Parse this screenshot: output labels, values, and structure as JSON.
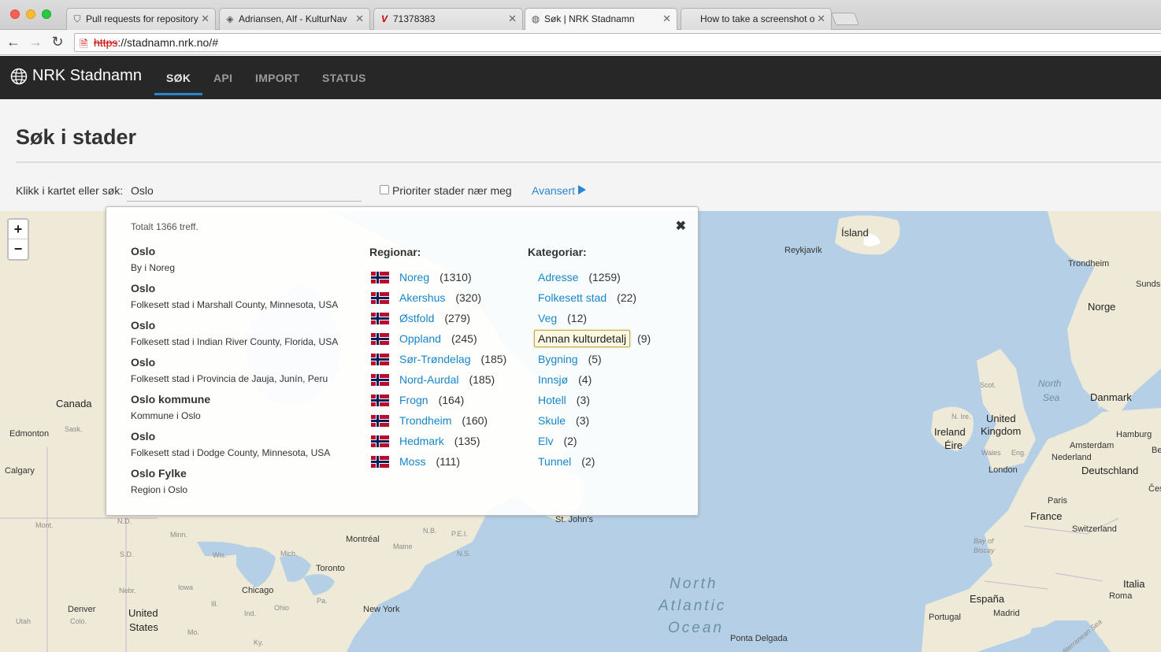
{
  "browser": {
    "tabs": [
      {
        "title": "Pull requests for repository",
        "icon": "shield-icon"
      },
      {
        "title": "Adriansen, Alf - KulturNav",
        "icon": "diamond-icon"
      },
      {
        "title": "71378383",
        "icon": "book-icon"
      },
      {
        "title": "Søk | NRK Stadnamn",
        "icon": "globe-icon",
        "active": true
      },
      {
        "title": "How to take a screenshot o",
        "icon": "apple-icon"
      }
    ],
    "url_scheme": "https",
    "url_rest": "://stadnamn.nrk.no/#"
  },
  "nav": {
    "brand": "NRK Stadnamn",
    "links": [
      "SØK",
      "API",
      "IMPORT",
      "STATUS"
    ]
  },
  "page": {
    "title": "Søk i stader",
    "search_label": "Klikk i kartet eller søk:",
    "search_value": "Oslo",
    "prio_label": "Prioriter stader nær meg",
    "advanced_label": "Avansert"
  },
  "results": {
    "total": "Totalt 1366 treff.",
    "hits": [
      {
        "name": "Oslo",
        "desc": "By i Noreg"
      },
      {
        "name": "Oslo",
        "desc": "Folkesett stad i Marshall County, Minnesota, USA"
      },
      {
        "name": "Oslo",
        "desc": "Folkesett stad i Indian River County, Florida, USA"
      },
      {
        "name": "Oslo",
        "desc": "Folkesett stad i Provincia de Jauja, Junín, Peru"
      },
      {
        "name": "Oslo kommune",
        "desc": "Kommune i Oslo"
      },
      {
        "name": "Oslo",
        "desc": "Folkesett stad i Dodge County, Minnesota, USA"
      },
      {
        "name": "Oslo Fylke",
        "desc": "Region i Oslo"
      }
    ],
    "regions_heading": "Regionar:",
    "regions": [
      {
        "name": "Noreg",
        "count": "(1310)"
      },
      {
        "name": "Akershus",
        "count": "(320)"
      },
      {
        "name": "Østfold",
        "count": "(279)"
      },
      {
        "name": "Oppland",
        "count": "(245)"
      },
      {
        "name": "Sør-Trøndelag",
        "count": "(185)"
      },
      {
        "name": "Nord-Aurdal",
        "count": "(185)"
      },
      {
        "name": "Frogn",
        "count": "(164)"
      },
      {
        "name": "Trondheim",
        "count": "(160)"
      },
      {
        "name": "Hedmark",
        "count": "(135)"
      },
      {
        "name": "Moss",
        "count": "(111)"
      }
    ],
    "categories_heading": "Kategoriar:",
    "categories": [
      {
        "name": "Adresse",
        "count": "(1259)"
      },
      {
        "name": "Folkesett stad",
        "count": "(22)"
      },
      {
        "name": "Veg",
        "count": "(12)"
      },
      {
        "name": "Annan kulturdetalj",
        "count": "(9)",
        "focused": true
      },
      {
        "name": "Bygning",
        "count": "(5)"
      },
      {
        "name": "Innsjø",
        "count": "(4)"
      },
      {
        "name": "Hotell",
        "count": "(3)"
      },
      {
        "name": "Skule",
        "count": "(3)"
      },
      {
        "name": "Elv",
        "count": "(2)"
      },
      {
        "name": "Tunnel",
        "count": "(2)"
      }
    ]
  },
  "map": {
    "zoom_in": "+",
    "zoom_out": "−",
    "labels": {
      "island": "Ísland",
      "reykjavik": "Reykjavík",
      "trondheim": "Trondheim",
      "sunds": "Sunds",
      "norge": "Norge",
      "north_sea_1": "North",
      "north_sea_2": "Sea",
      "danmark": "Danmark",
      "scot": "Scot.",
      "united_kingdom_1": "United",
      "united_kingdom_2": "Kingdom",
      "ireland": "Ireland",
      "eire": "Éire",
      "n_ire": "N. Ire.",
      "wales": "Wales",
      "eng": "Eng.",
      "london": "London",
      "amsterdam": "Amsterdam",
      "hamburg": "Hamburg",
      "nederland": "Nederland",
      "ber": "Ber",
      "deutschland": "Deutschland",
      "ces": "Čes",
      "paris": "Paris",
      "france": "France",
      "switzerland": "Switzerland",
      "bay_of_biscay_1": "Bay of",
      "bay_of_biscay_2": "Biscay",
      "italia": "Italia",
      "roma": "Roma",
      "espana": "España",
      "madrid": "Madrid",
      "portugal": "Portugal",
      "mediterranean": "Mediterranean Sea",
      "atlantic_1": "North",
      "atlantic_2": "Atlantic",
      "atlantic_3": "Ocean",
      "ponta_delgada": "Ponta Delgada",
      "st_johns": "St. John's",
      "canada": "Canada",
      "edmonton": "Edmonton",
      "sask": "Sask.",
      "calgary": "Calgary",
      "mont": "Mont.",
      "nd": "N.D.",
      "sd": "S.D.",
      "minn": "Minn.",
      "wis": "Wis.",
      "nebr": "Nebr.",
      "iowa": "Iowa",
      "mich": "Mich.",
      "ohio": "Ohio",
      "ill": "Ill.",
      "ind": "Ind.",
      "mo": "Mo.",
      "ky": "Ky.",
      "utah": "Utah",
      "colo": "Colo.",
      "denver": "Denver",
      "united_states_1": "United",
      "united_states_2": "States",
      "chicago": "Chicago",
      "toronto": "Toronto",
      "montreal": "Montréal",
      "maine": "Maine",
      "pa": "Pa.",
      "new_york": "New York",
      "nb": "N.B.",
      "pei": "P.E.I.",
      "ns": "N.S."
    }
  },
  "colors": {
    "nav_bg": "#272727",
    "accent": "#2a86d1",
    "link": "#1686c9",
    "sea": "#b5d0e6",
    "land": "#eeead7"
  }
}
